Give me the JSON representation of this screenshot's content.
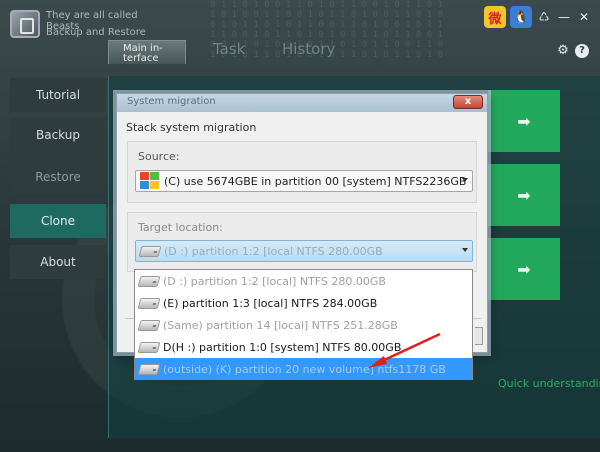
{
  "app": {
    "title": "They are all called Beasts",
    "subtitle": "Backup and Restore",
    "icons": {
      "weibo": "weibo-icon",
      "qq": "qq-penguin-icon",
      "minimize": "minimize-icon",
      "close": "close-icon",
      "settings": "gear-icon",
      "help": "help-icon"
    }
  },
  "tabs": [
    {
      "label": "Main in-\nterface",
      "active": true
    },
    {
      "label": "Task",
      "active": false
    },
    {
      "label": "History",
      "active": false
    }
  ],
  "sidebar": [
    {
      "label": "Tutorial",
      "state": "normal"
    },
    {
      "label": "Backup",
      "state": "normal"
    },
    {
      "label": "Restore",
      "state": "dim"
    },
    {
      "label": "Clone",
      "state": "active"
    },
    {
      "label": "About",
      "state": "normal"
    }
  ],
  "quick_link": "Quick understanding",
  "dialog": {
    "title": "System migration",
    "close_label": "x",
    "heading": "Stack system migration",
    "source": {
      "label": "Source:",
      "value": "(C) use 5674GBE in partition 00 [system] NTFS2236GB"
    },
    "target": {
      "label": "Target location:",
      "value": "(D :) partition 1:2 [local NTFS 280.00GB"
    },
    "options": [
      {
        "label": "(D :) partition 1:2 [local] NTFS 280.00GB",
        "state": "disabled"
      },
      {
        "label": "(E) partition 1:3 [local] NTFS 284.00GB",
        "state": "normal"
      },
      {
        "label": "(Same) partition 14 [local] NTFS 251.28GB",
        "state": "disabled"
      },
      {
        "label": "D(H :) partition 1:0 [system] NTFS 80.00GB",
        "state": "normal"
      },
      {
        "label": "(outside) (K) partition 20 new volume] ntfs1178 GB",
        "state": "selected"
      }
    ]
  },
  "colors": {
    "accent_green": "#22a85c",
    "clone_active": "#1e6a60",
    "selection_blue": "#3399ff",
    "arrow_red": "#e02020"
  }
}
